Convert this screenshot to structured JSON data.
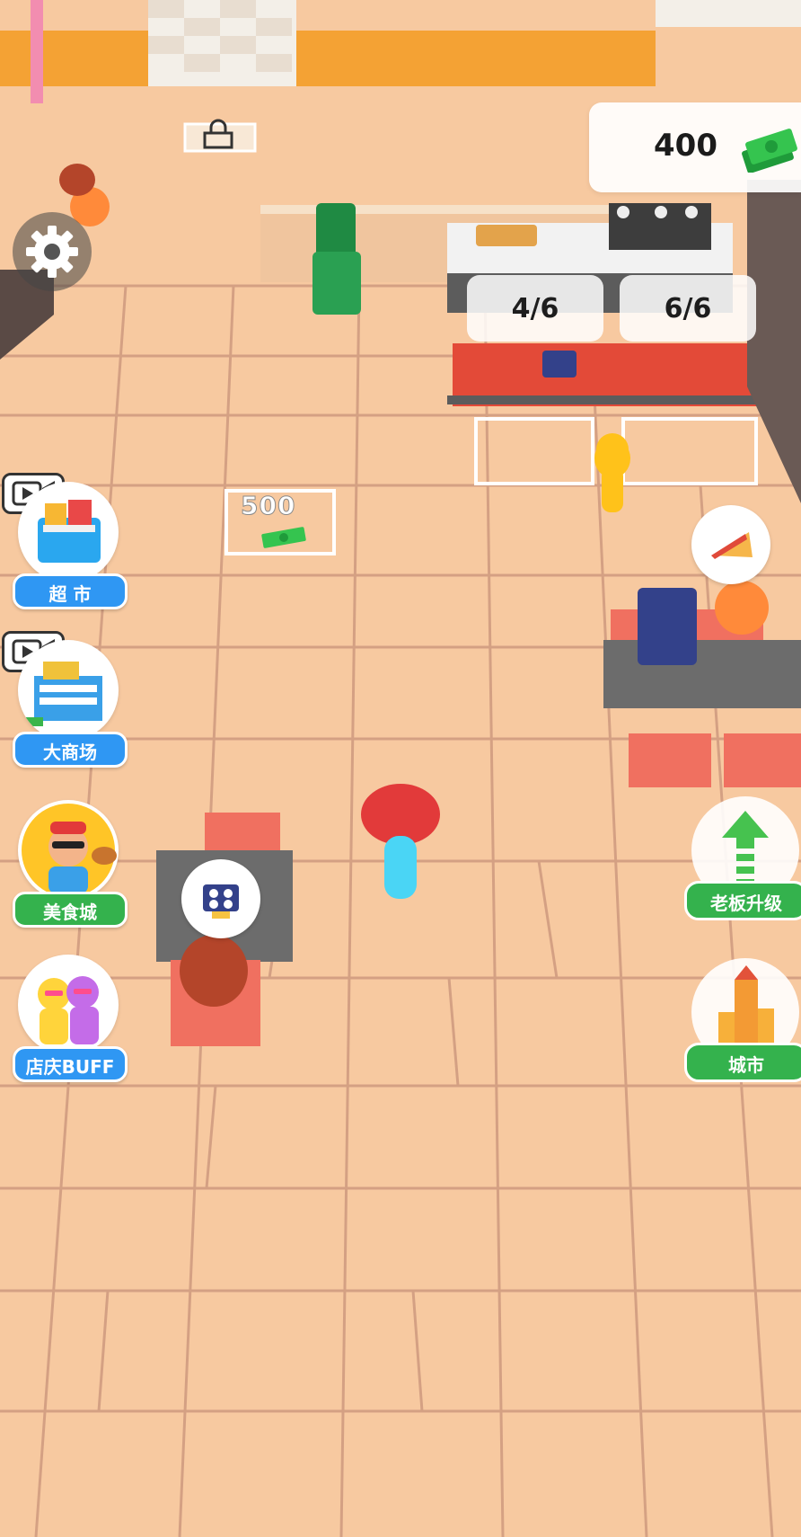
{
  "hud": {
    "money": "400",
    "counters": [
      "4/6",
      "6/6"
    ],
    "unlock_price": "500"
  },
  "left_menu": [
    {
      "label": "超 市",
      "icon": "supermarket-icon",
      "has_video": true
    },
    {
      "label": "大商场",
      "icon": "mall-icon",
      "has_video": true
    },
    {
      "label": "美食城",
      "icon": "food-court-icon",
      "has_video": false
    },
    {
      "label": "店庆BUFF",
      "icon": "buff-icon",
      "has_video": false
    }
  ],
  "right_menu": [
    {
      "label": "老板升级",
      "icon": "upgrade-arrow-icon"
    },
    {
      "label": "城市",
      "icon": "city-icon"
    }
  ],
  "colors": {
    "floor": "#f7c9a0",
    "floor_lines": "#c9937a",
    "button_blue": "#2f97f3",
    "button_green": "#34b24d",
    "counter_red": "#e34a38"
  }
}
